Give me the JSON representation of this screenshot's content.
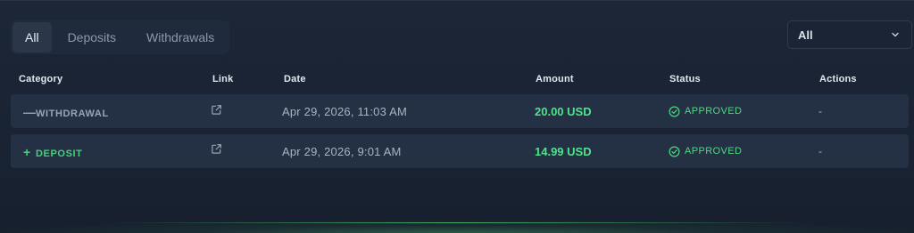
{
  "tabs": [
    {
      "label": "All",
      "active": true
    },
    {
      "label": "Deposits",
      "active": false
    },
    {
      "label": "Withdrawals",
      "active": false
    }
  ],
  "filter": {
    "selected": "All"
  },
  "table": {
    "headers": {
      "category": "Category",
      "link": "Link",
      "date": "Date",
      "amount": "Amount",
      "status": "Status",
      "actions": "Actions"
    },
    "rows": [
      {
        "sign": "—",
        "category": "WITHDRAWAL",
        "date": "Apr 29, 2026, 11:03 AM",
        "amount": "20.00 USD",
        "status": "APPROVED",
        "action": "-"
      },
      {
        "sign": "+",
        "category": "DEPOSIT",
        "date": "Apr 29, 2026, 9:01 AM",
        "amount": "14.99 USD",
        "status": "APPROVED",
        "action": "-"
      }
    ]
  },
  "colors": {
    "background": "#1b2536",
    "row_background": "#243044",
    "accent_green": "#4fe48a",
    "muted_text": "#aab3c3"
  },
  "icons": {
    "link": "external-link-icon",
    "status": "check-circle-icon",
    "filter": "chevron-down-icon"
  }
}
